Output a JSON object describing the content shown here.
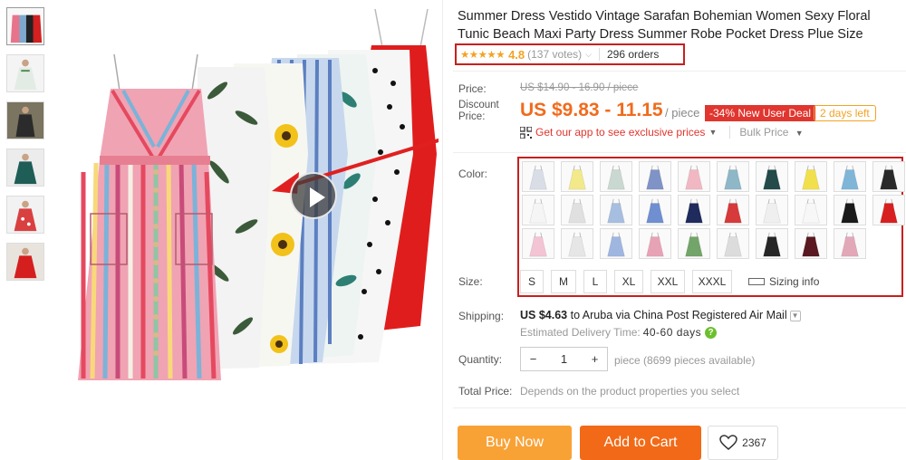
{
  "product": {
    "title": "Summer Dress Vestido Vintage Sarafan Bohemian Women Sexy Floral Tunic Beach Maxi Party Dress Summer Robe Pocket Dress Plue Size"
  },
  "rating": {
    "stars": "★★★★★",
    "value": "4.8",
    "votes": "(137 votes)",
    "orders": "296 orders"
  },
  "price": {
    "label": "Price:",
    "original": "US $14.90 - 16.90 / piece",
    "discount_label_1": "Discount",
    "discount_label_2": "Price:",
    "discounted": "US $9.83 - 11.15",
    "per": "/ piece",
    "deal_badge": "-34% New User Deal",
    "days_left": "2 days left",
    "app_link": "Get our app to see exclusive prices",
    "bulk_price": "Bulk Price"
  },
  "options": {
    "color_label": "Color:",
    "size_label": "Size:",
    "sizes": [
      "S",
      "M",
      "L",
      "XL",
      "XXL",
      "XXXL"
    ],
    "sizing_info": "Sizing info",
    "swatch_colors": [
      "#d8dde6",
      "#f2e98a",
      "#c9d8d0",
      "#7f93c7",
      "#f1b8c4",
      "#8eb7c7",
      "#244a4a",
      "#f1e04b",
      "#7fb6d8",
      "#2a2a2a",
      "#f5f5f5",
      "#e0e0e0",
      "#a6bedf",
      "#6f8fd0",
      "#1f2b5c",
      "#d63a3a",
      "#efefef",
      "#f7f7f7",
      "#1a1a1a",
      "#d81f1f",
      "#f3c4d3",
      "#e6e6e6",
      "#9fb6e0",
      "#e8a2b5",
      "#73a469",
      "#dcdcdc",
      "#262626",
      "#5a1820",
      "#e2a8b8"
    ]
  },
  "shipping": {
    "label": "Shipping:",
    "amount": "US $4.63",
    "text": " to Aruba via China Post Registered Air Mail",
    "est_label": "Estimated Delivery Time:",
    "est_days": "40-60 days"
  },
  "quantity": {
    "label": "Quantity:",
    "minus": "−",
    "value": "1",
    "plus": "+",
    "available": "piece (8699 pieces available)"
  },
  "total": {
    "label": "Total Price:",
    "note": "Depends on the product properties you select"
  },
  "actions": {
    "buy_now": "Buy Now",
    "add_to_cart": "Add to Cart",
    "wishlist_count": "2367"
  },
  "colors": {
    "accent_red": "#e0362f",
    "price_orange": "#f06b1d",
    "buy_orange": "#f8a236",
    "cart_orange": "#f26a17",
    "star_gold": "#f3a323",
    "highlight_box": "#c7201f"
  }
}
